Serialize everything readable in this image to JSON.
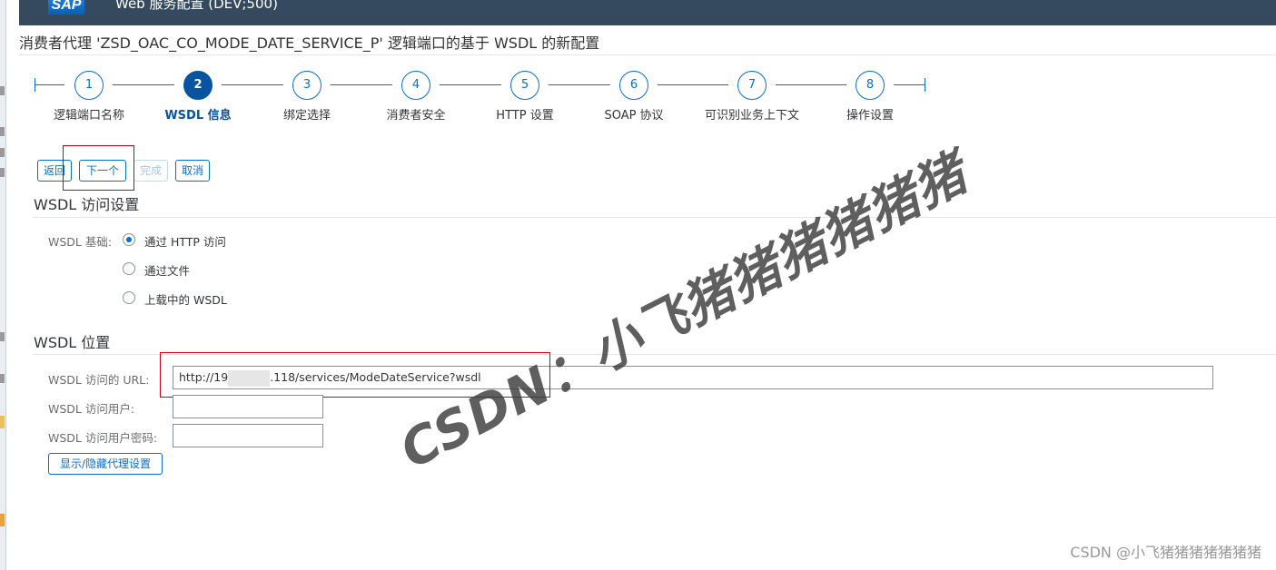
{
  "header": {
    "logo_text": "SAP",
    "app_title": "Web 服务配置 (DEV;500)"
  },
  "page_title": "消费者代理 'ZSD_OAC_CO_MODE_DATE_SERVICE_P' 逻辑端口的基于 WSDL 的新配置",
  "roadmap": {
    "steps": [
      {
        "number": "1",
        "label": "逻辑端口名称",
        "active": false
      },
      {
        "number": "2",
        "label": "WSDL 信息",
        "active": true
      },
      {
        "number": "3",
        "label": "绑定选择",
        "active": false
      },
      {
        "number": "4",
        "label": "消费者安全",
        "active": false
      },
      {
        "number": "5",
        "label": "HTTP 设置",
        "active": false
      },
      {
        "number": "6",
        "label": "SOAP 协议",
        "active": false
      },
      {
        "number": "7",
        "label": "可识别业务上下文",
        "active": false
      },
      {
        "number": "8",
        "label": "操作设置",
        "active": false
      }
    ]
  },
  "toolbar": {
    "back_label": "返回",
    "next_label": "下一个",
    "finish_label": "完成",
    "cancel_label": "取消"
  },
  "access_section": {
    "title": "WSDL 访问设置",
    "basis_label": "WSDL 基础:",
    "options": [
      {
        "label": "通过 HTTP 访问",
        "selected": true
      },
      {
        "label": "通过文件",
        "selected": false
      },
      {
        "label": "上载中的 WSDL",
        "selected": false
      }
    ]
  },
  "location_section": {
    "title": "WSDL 位置",
    "url_label": "WSDL 访问的 URL:",
    "url_prefix": "http://19",
    "url_suffix": ".118/services/ModeDateService?wsdl",
    "user_label": "WSDL 访问用户:",
    "user_value": "",
    "password_label": "WSDL 访问用户密码:",
    "password_value": "",
    "proxy_button_label": "显示/隐藏代理设置"
  },
  "watermark": {
    "text": "CSDN：小飞猪猪猪猪猪猪",
    "footer_text": "CSDN @小飞猪猪猪猪猪猪猪"
  },
  "colors": {
    "header_bg": "#354a5f",
    "accent": "#0a6ed1",
    "active_step": "#0854a0",
    "annotation_red": "#d0021b"
  }
}
